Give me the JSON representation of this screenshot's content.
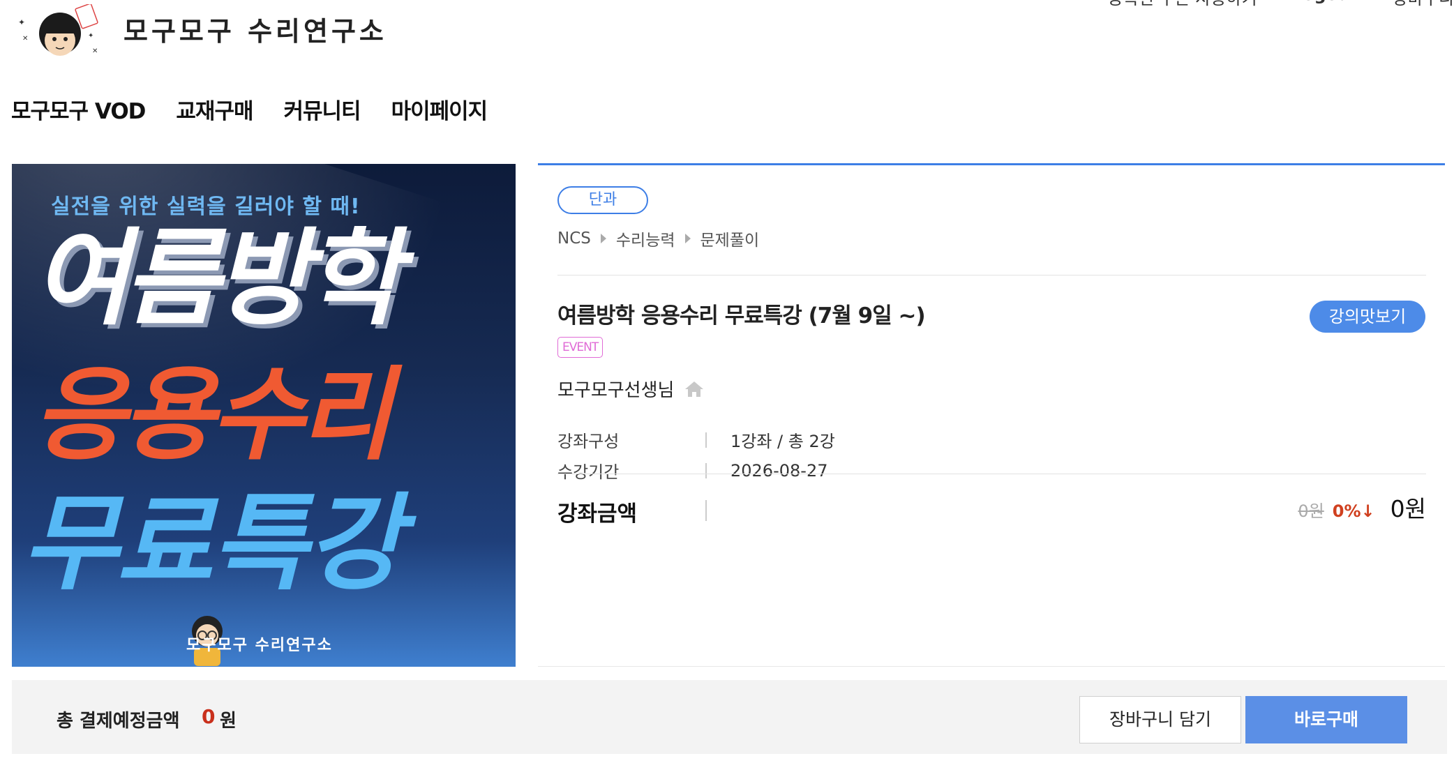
{
  "header": {
    "brand": "모구모구 수리연구소",
    "top_links": [
      "등록된 쿠폰 사용하기",
      "Logout",
      "장바구니"
    ]
  },
  "nav": {
    "items": [
      {
        "label": "모구모구 VOD"
      },
      {
        "label": "교재구매"
      },
      {
        "label": "커뮤니티"
      },
      {
        "label": "마이페이지"
      }
    ]
  },
  "banner": {
    "subtitle": "실전을 위한 실력을 길러야 할 때!",
    "line1": "여름방학",
    "line2": "응용수리",
    "line3": "무료특강",
    "footer_brand": "모구모구 수리연구소",
    "colors": {
      "line2": "#f05a32",
      "line3": "#56b8f5"
    }
  },
  "course": {
    "tag": "단과",
    "breadcrumb": [
      "NCS",
      "수리능력",
      "문제풀이"
    ],
    "title": "여름방학 응용수리 무료특강 (7월 9일 ~)",
    "preview_label": "강의맛보기",
    "badge": "EVENT",
    "teacher": "모구모구선생님",
    "details": [
      {
        "label": "강좌구성",
        "value": "1강좌 / 총 2강"
      },
      {
        "label": "수강기간",
        "value": "2026-08-27"
      }
    ],
    "price": {
      "label": "강좌금액",
      "original": "0원",
      "discount": "0%↓",
      "final": "0원"
    }
  },
  "checkout": {
    "total_label": "총 결제예정금액",
    "total_value": "0",
    "total_unit": "원",
    "cart_label": "장바구니 담기",
    "buy_label": "바로구매"
  },
  "colors": {
    "accent": "#3d7ee6",
    "buy": "#5b8fe6",
    "event": "#e06bd6",
    "discount": "#d0401f"
  }
}
